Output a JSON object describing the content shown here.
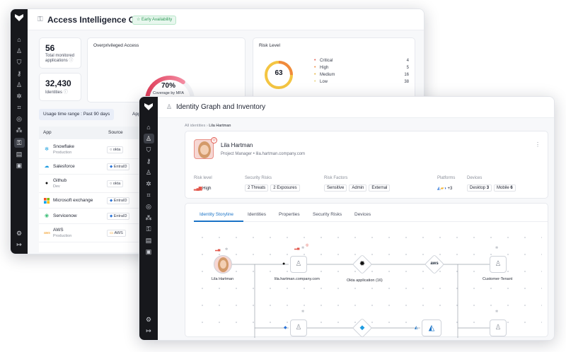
{
  "colors": {
    "rail": "#17181c",
    "accent": "#1a73c7",
    "critical": "#e2574c",
    "high": "#f08a3c",
    "medium": "#e7b43b",
    "low": "#e8d27a",
    "success": "#2f9a58"
  },
  "back_window": {
    "title": "Access Intelligence Cloud",
    "availability_badge": "☆ Early Availability",
    "stats": [
      {
        "value": "56",
        "label": "Total monitored applications"
      },
      {
        "value": "32,430",
        "label": "Identities"
      }
    ],
    "overprivileged": {
      "title": "Overprivileged Access",
      "percent": "70%",
      "caption": "Coverage by MFA",
      "coverage_fraction": 0.7
    },
    "risk_level": {
      "title": "Risk Level",
      "score": "63",
      "items": [
        {
          "label": "Critical",
          "value": "4"
        },
        {
          "label": "High",
          "value": "5"
        },
        {
          "label": "Medium",
          "value": "16"
        },
        {
          "label": "Low",
          "value": "38"
        }
      ]
    },
    "filters": {
      "usage": "Usage time range : Past 90 days",
      "app": "App : All"
    },
    "apps_table": {
      "headers": [
        "App",
        "Source"
      ],
      "rows": [
        {
          "name": "Snowflake",
          "sub": "Production",
          "source": "okta",
          "icon": "snowflake-icon"
        },
        {
          "name": "Salesforce",
          "sub": "",
          "source": "EntraID",
          "icon": "cloud-icon"
        },
        {
          "name": "Github",
          "sub": "Dev",
          "source": "okta",
          "icon": "github-icon"
        },
        {
          "name": "Microsoft exchange",
          "sub": "",
          "source": "EntraID",
          "icon": "microsoft-icon"
        },
        {
          "name": "Servicenow",
          "sub": "",
          "source": "EntraID",
          "icon": "servicenow-icon"
        },
        {
          "name": "AWS",
          "sub": "Production",
          "source": "AWS",
          "icon": "aws-icon"
        }
      ]
    }
  },
  "front_window": {
    "title": "Identity Graph and Inventory",
    "breadcrumb": {
      "root": "All identities",
      "sep": "›",
      "current": "Lila Hartman"
    },
    "profile": {
      "name": "Lila Hartman",
      "role": "Project Manager",
      "email": "lila.hartman.company.com",
      "risk_level_label": "Risk level",
      "risk_level_value": "High",
      "security_risks_label": "Security Risks",
      "security_risks": [
        "2 Threats",
        "2 Exposures"
      ],
      "risk_factors_label": "Risk Factors",
      "risk_factors": [
        "Sensitive",
        "Admin",
        "External"
      ],
      "platforms_label": "Platforms",
      "platforms_more": "+3",
      "devices_label": "Devices",
      "devices": [
        {
          "name": "Desktop",
          "count": "3"
        },
        {
          "name": "Mobile",
          "count": "6"
        }
      ]
    },
    "tabs": [
      "Identity Storyline",
      "Identities",
      "Properties",
      "Security Risks",
      "Devices"
    ],
    "graph": {
      "nodes": [
        "Lila Hartman",
        "lila.hartman.company.com",
        "Okta application (16)",
        "Customer-Tenant"
      ],
      "aws_label": "aws"
    }
  }
}
